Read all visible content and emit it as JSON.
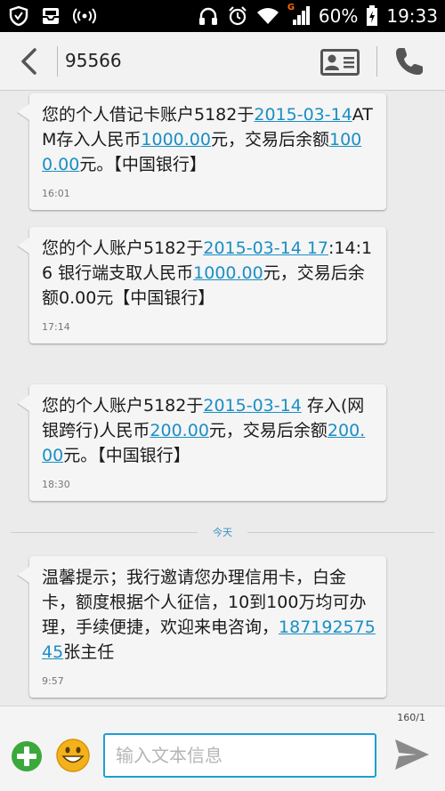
{
  "status_bar": {
    "battery_percent": "60%",
    "time": "19:33",
    "network_badge": "G"
  },
  "header": {
    "title": "95566"
  },
  "messages": [
    {
      "parts": [
        "您的个人借记卡账户5182于",
        "2015-03-14",
        "ATM存入人民币",
        "1000.00",
        "元，交易后余额",
        "1000.00",
        "元。【中国银行】"
      ],
      "time": "16:01"
    },
    {
      "parts": [
        "您的个人账户5182于",
        "2015-03-14 17",
        ":14:16 银行端支取人民币",
        "1000.00",
        "元，交易后余额0.00元【中国银行】"
      ],
      "time": "17:14"
    },
    {
      "parts": [
        "您的个人账户5182于",
        "2015-03-14",
        " 存入(网银跨行)人民币",
        "200.00",
        "元，交易后余额",
        "200.00",
        "元。【中国银行】"
      ],
      "time": "18:30"
    },
    {
      "parts": [
        "温馨提示；我行邀请您办理信用卡，白金卡，额度根据个人征信，10到100万均可办理，手续便捷，欢迎来电咨询，",
        "18719257545",
        "张主任"
      ],
      "time": "9:57"
    }
  ],
  "day_divider": {
    "label": "今天"
  },
  "compose": {
    "char_counter": "160/1",
    "placeholder": "输入文本信息"
  },
  "colors": {
    "link": "#1a8fc4",
    "input_border": "#1d9ed6",
    "attach_green": "#3aa93a",
    "status_bar": "#000000"
  }
}
